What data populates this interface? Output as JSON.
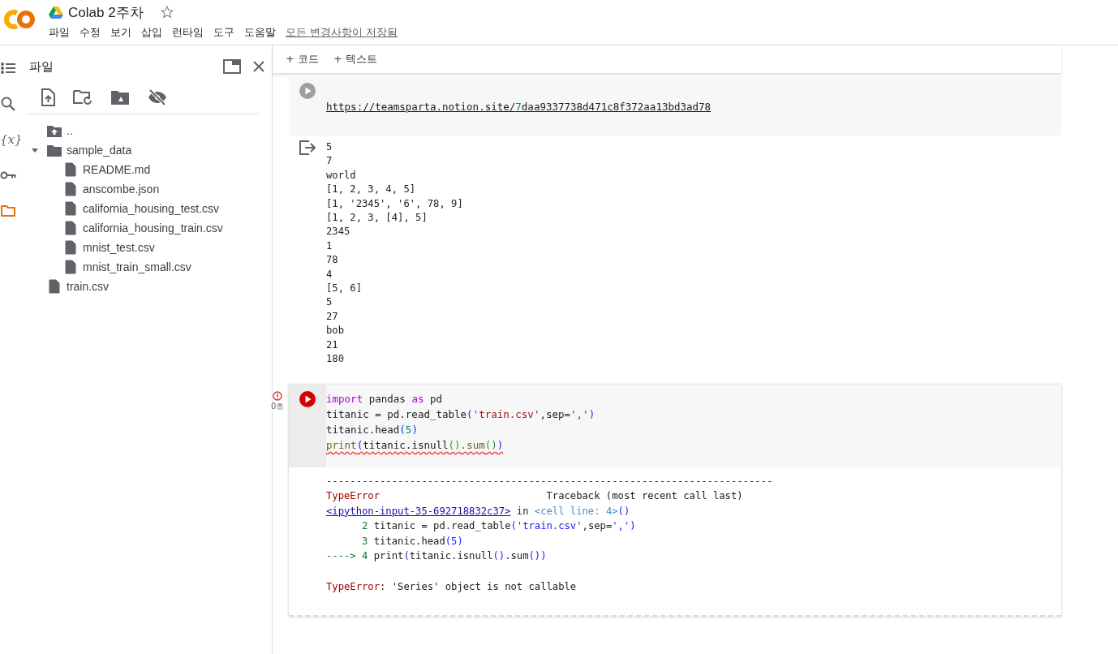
{
  "header": {
    "title": "Colab 2주차",
    "starred": false,
    "menu": [
      "파일",
      "수정",
      "보기",
      "삽입",
      "런타임",
      "도구",
      "도움말"
    ],
    "save_status": "모든 변경사항이 저장됨"
  },
  "rail": [
    {
      "kind": "toc",
      "selected": false
    },
    {
      "kind": "search",
      "selected": false
    },
    {
      "kind": "variables",
      "glyph": "{x}",
      "selected": false
    },
    {
      "kind": "secrets",
      "selected": false
    },
    {
      "kind": "files",
      "selected": true
    }
  ],
  "file_panel": {
    "title": "파일",
    "tree": [
      {
        "name": "..",
        "kind": "parent"
      },
      {
        "name": "sample_data",
        "kind": "folder",
        "expanded": true,
        "children": [
          {
            "name": "README.md",
            "kind": "file"
          },
          {
            "name": "anscombe.json",
            "kind": "file"
          },
          {
            "name": "california_housing_test.csv",
            "kind": "file"
          },
          {
            "name": "california_housing_train.csv",
            "kind": "file"
          },
          {
            "name": "mnist_test.csv",
            "kind": "file"
          },
          {
            "name": "mnist_train_small.csv",
            "kind": "file"
          }
        ]
      },
      {
        "name": "train.csv",
        "kind": "file"
      }
    ]
  },
  "toolbar": [
    "+ 코드",
    "+ 텍스트"
  ],
  "cells": [
    {
      "error": false,
      "focused": false,
      "code": [
        {
          "underline": true,
          "squiggle": false,
          "tokens": [
            {
              "text": "https://teamsparta.notion.site/",
              "kind": "plain"
            },
            {
              "text": "7",
              "kind": "number"
            },
            {
              "text": "daa9337738d471c8f372aa13bd3ad78",
              "kind": "plain"
            }
          ]
        }
      ],
      "output": {
        "kind": "stream",
        "lines": [
          {
            "tokens": [
              {
                "text": "5",
                "kind": "plain"
              }
            ]
          },
          {
            "tokens": [
              {
                "text": "7",
                "kind": "plain"
              }
            ]
          },
          {
            "tokens": [
              {
                "text": "world",
                "kind": "plain"
              }
            ]
          },
          {
            "tokens": [
              {
                "text": "[1, 2, 3, 4, 5]",
                "kind": "plain"
              }
            ]
          },
          {
            "tokens": [
              {
                "text": "[1, '2345', '6', 78, 9]",
                "kind": "plain"
              }
            ]
          },
          {
            "tokens": [
              {
                "text": "[1, 2, 3, [4], 5]",
                "kind": "plain"
              }
            ]
          },
          {
            "tokens": [
              {
                "text": "2345",
                "kind": "plain"
              }
            ]
          },
          {
            "tokens": [
              {
                "text": "1",
                "kind": "plain"
              }
            ]
          },
          {
            "tokens": [
              {
                "text": "78",
                "kind": "plain"
              }
            ]
          },
          {
            "tokens": [
              {
                "text": "4",
                "kind": "plain"
              }
            ]
          },
          {
            "tokens": [
              {
                "text": "[5, 6]",
                "kind": "plain"
              }
            ]
          },
          {
            "tokens": [
              {
                "text": "5",
                "kind": "plain"
              }
            ]
          },
          {
            "tokens": [
              {
                "text": "27",
                "kind": "plain"
              }
            ]
          },
          {
            "tokens": [
              {
                "text": "bob",
                "kind": "plain"
              }
            ]
          },
          {
            "tokens": [
              {
                "text": "21",
                "kind": "plain"
              }
            ]
          },
          {
            "tokens": [
              {
                "text": "180",
                "kind": "plain"
              }
            ]
          }
        ]
      }
    },
    {
      "error": true,
      "exec_time": "0초",
      "focused": true,
      "code": [
        {
          "underline": false,
          "squiggle": false,
          "tokens": [
            {
              "text": "import",
              "kind": "keyword"
            },
            {
              "text": " pandas ",
              "kind": "plain"
            },
            {
              "text": "as",
              "kind": "keyword"
            },
            {
              "text": " pd",
              "kind": "plain"
            }
          ]
        },
        {
          "underline": false,
          "squiggle": false,
          "tokens": [
            {
              "text": "titanic = pd.read_table",
              "kind": "plain"
            },
            {
              "text": "(",
              "kind": "paren"
            },
            {
              "text": "'train.csv'",
              "kind": "string"
            },
            {
              "text": ",sep=",
              "kind": "plain"
            },
            {
              "text": "','",
              "kind": "string"
            },
            {
              "text": ")",
              "kind": "paren"
            }
          ]
        },
        {
          "underline": false,
          "squiggle": false,
          "tokens": [
            {
              "text": "titanic.head",
              "kind": "plain"
            },
            {
              "text": "(",
              "kind": "paren"
            },
            {
              "text": "5",
              "kind": "number"
            },
            {
              "text": ")",
              "kind": "paren"
            }
          ]
        },
        {
          "underline": false,
          "squiggle": true,
          "tokens": [
            {
              "text": "print",
              "kind": "builtin"
            },
            {
              "text": "(",
              "kind": "paren"
            },
            {
              "text": "titanic.isnull",
              "kind": "plain"
            },
            {
              "text": "()",
              "kind": "paren2"
            },
            {
              "text": ".sum",
              "kind": "builtin"
            },
            {
              "text": "()",
              "kind": "paren2"
            },
            {
              "text": ")",
              "kind": "paren"
            }
          ]
        }
      ],
      "output": {
        "kind": "error",
        "lines": [
          {
            "tokens": [
              {
                "text": "---------------------------------------------------------------------------",
                "kind": "error"
              }
            ]
          },
          {
            "tokens": [
              {
                "text": "TypeError",
                "kind": "error"
              },
              {
                "text": "                            Traceback (most recent call last)",
                "kind": "plain"
              }
            ]
          },
          {
            "tokens": [
              {
                "text": "<ipython-input-35-692718832c37>",
                "kind": "link"
              },
              {
                "text": " in ",
                "kind": "plain"
              },
              {
                "text": "<cell line: 4>",
                "kind": "meta"
              },
              {
                "text": "()",
                "kind": "tbparen"
              }
            ]
          },
          {
            "tokens": [
              {
                "text": "      2",
                "kind": "lineno"
              },
              {
                "text": " titanic = pd",
                "kind": "plain"
              },
              {
                "text": ".",
                "kind": "tbparen"
              },
              {
                "text": "read_table",
                "kind": "plain"
              },
              {
                "text": "(",
                "kind": "tbparen"
              },
              {
                "text": "'train.csv'",
                "kind": "tbstring"
              },
              {
                "text": ",sep=",
                "kind": "plain"
              },
              {
                "text": "','",
                "kind": "tbstring"
              },
              {
                "text": ")",
                "kind": "tbparen"
              }
            ]
          },
          {
            "tokens": [
              {
                "text": "      3",
                "kind": "lineno"
              },
              {
                "text": " titanic.head",
                "kind": "plain"
              },
              {
                "text": "(",
                "kind": "tbparen"
              },
              {
                "text": "5",
                "kind": "tbstring"
              },
              {
                "text": ")",
                "kind": "tbparen"
              }
            ]
          },
          {
            "tokens": [
              {
                "text": "----> 4",
                "kind": "lineno"
              },
              {
                "text": " print",
                "kind": "plain"
              },
              {
                "text": "(",
                "kind": "tbparen"
              },
              {
                "text": "titanic.isnull",
                "kind": "plain"
              },
              {
                "text": "()",
                "kind": "tbparen"
              },
              {
                "text": ".sum",
                "kind": "plain"
              },
              {
                "text": "()",
                "kind": "tbparen"
              },
              {
                "text": ")",
                "kind": "tbparen"
              }
            ]
          },
          {
            "blank_before": true,
            "tokens": [
              {
                "text": "TypeError",
                "kind": "error"
              },
              {
                "text": ": 'Series' object is not callable",
                "kind": "plain"
              }
            ]
          }
        ]
      }
    }
  ]
}
